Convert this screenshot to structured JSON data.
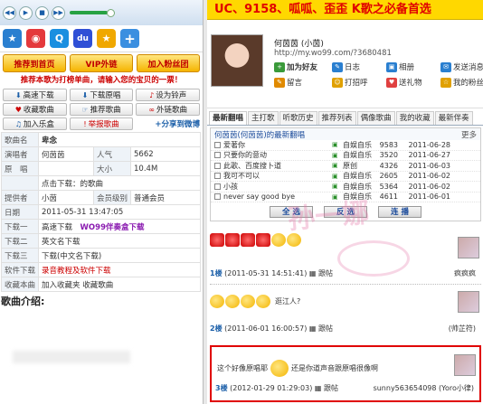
{
  "player": {
    "buttons": [
      "◀◀",
      "▶",
      "■",
      "▶▶"
    ]
  },
  "toolbar_icons": [
    {
      "name": "star-icon",
      "glyph": "★",
      "color": "#2a7fd0"
    },
    {
      "name": "weibo-icon",
      "glyph": "◉",
      "color": "#e4393c"
    },
    {
      "name": "qq-icon",
      "glyph": "Q",
      "color": "#1a8fe0"
    },
    {
      "name": "baidu-icon",
      "glyph": "du",
      "color": "#2f4fd6"
    },
    {
      "name": "favorite-star-icon",
      "glyph": "★",
      "color": "#f0a800"
    },
    {
      "name": "plus-icon",
      "glyph": "+",
      "color": "#3b8fe0"
    }
  ],
  "yellow_buttons": [
    "推荐到首页",
    "VIP外链",
    "加入粉丝团"
  ],
  "notice": "推荐本歌为打榜单曲，请输入您的宝贝的一票！",
  "actions": [
    {
      "label": "高速下载",
      "icon": "⬇",
      "color": "#1a5ea8"
    },
    {
      "label": "下载原唱",
      "icon": "⬇",
      "color": "#1a5ea8"
    },
    {
      "label": "设为铃声",
      "icon": "♪",
      "color": "#c00"
    },
    {
      "label": "收藏歌曲",
      "icon": "♥",
      "color": "#c00"
    },
    {
      "label": "推荐歌曲",
      "icon": "☞",
      "color": "#1a5ea8"
    },
    {
      "label": "外链歌曲",
      "icon": "∞",
      "color": "#c00"
    },
    {
      "label": "加入乐盒",
      "icon": "♫",
      "color": "#1a5ea8"
    },
    {
      "label": "举报歌曲",
      "icon": "!",
      "color": "#c00"
    }
  ],
  "share_label": "+分享到微博",
  "info": {
    "song_name_label": "歌曲名",
    "song_name": "卑念",
    "singer_label": "演唱者",
    "singer": "何茵茵",
    "popularity_label": "人气",
    "popularity": "5662",
    "original_label": "原　唱",
    "original": "",
    "size_label": "大小",
    "size": "10.4M",
    "download_hint": "点击下载：的歌曲",
    "provider_label": "提供者",
    "provider": "小茵",
    "level_label": "会员级别",
    "level": "普通会员",
    "date_label": "日期",
    "date": "2011-05-31 13:47:05",
    "dl1_label": "下载一",
    "dl1": "高速下载",
    "dl1_extra": "WO99伴奏盒下载",
    "dl2_label": "下载二",
    "dl2": "英文名下载",
    "dl3_label": "下载三",
    "dl3": "下载(中文名下载)",
    "software_label": "软件下载",
    "software": "录音教程及软件下载",
    "favorite_label": "收藏本曲",
    "favorite": "加入收藏夹 收藏歌曲"
  },
  "intro_label": "歌曲介绍:",
  "banner": "UC、9158、呱呱、歪歪 K歌之必备首选",
  "profile": {
    "name": "何茵茵 (小茵)",
    "url": "http://my.wo99.com/?3680481",
    "links": [
      {
        "label": "加为好友",
        "icon": "+",
        "color": "#3a9a3a"
      },
      {
        "label": "日志",
        "icon": "✎",
        "color": "#2a7fd0"
      },
      {
        "label": "相册",
        "icon": "▣",
        "color": "#2a7fd0"
      },
      {
        "label": "发送消息",
        "icon": "✉",
        "color": "#2a7fd0"
      },
      {
        "label": "留言",
        "icon": "✎",
        "color": "#e08a00"
      },
      {
        "label": "打招呼",
        "icon": "☺",
        "color": "#e0a000"
      },
      {
        "label": "送礼物",
        "icon": "♥",
        "color": "#e04040"
      },
      {
        "label": "我的粉丝",
        "icon": "☆",
        "color": "#e0a000"
      }
    ]
  },
  "tabs": [
    "最新翻唱",
    "主打歌",
    "听歌历史",
    "推荐列表",
    "偶像歌曲",
    "我的收藏",
    "最新伴奏"
  ],
  "list": {
    "title": "何茵茵(何茵茵)的最新翻唱",
    "more": "更多",
    "songs": [
      {
        "name": "爱著你",
        "type": "自娱自乐",
        "num": "9583",
        "date": "2011-06-28"
      },
      {
        "name": "只要你的意动",
        "type": "自娱自乐",
        "num": "3520",
        "date": "2011-06-27"
      },
      {
        "name": "此歌、百度搜卜道",
        "type": "原创",
        "num": "4326",
        "date": "2011-06-03"
      },
      {
        "name": "我可不可以",
        "type": "自娱自乐",
        "num": "2605",
        "date": "2011-06-02"
      },
      {
        "name": "小孩",
        "type": "自娱自乐",
        "num": "5364",
        "date": "2011-06-02"
      },
      {
        "name": "never say good bye",
        "type": "自娱自乐",
        "num": "4611",
        "date": "2011-06-01"
      }
    ],
    "buttons": [
      "全 选",
      "反 选",
      "连 播"
    ]
  },
  "comments": [
    {
      "floor": "1楼",
      "meta": "(2011-05-31 14:51:41)",
      "reply": "跟帖",
      "user": "疯疯疯"
    },
    {
      "floor": "2楼",
      "text": "逛江人?",
      "meta": "(2011-06-01 16:00:57)",
      "reply": "跟帖",
      "user": "(帅芷符)"
    },
    {
      "floor": "3楼",
      "text": "这个好像原唱耶",
      "text2": "还是你道声音跟原唱很像啊",
      "meta": "(2012-01-29 01:29:03)",
      "reply": "跟帖",
      "user": "sunny563654098 (Yoro小律)"
    }
  ],
  "watermark": "孙一娜"
}
